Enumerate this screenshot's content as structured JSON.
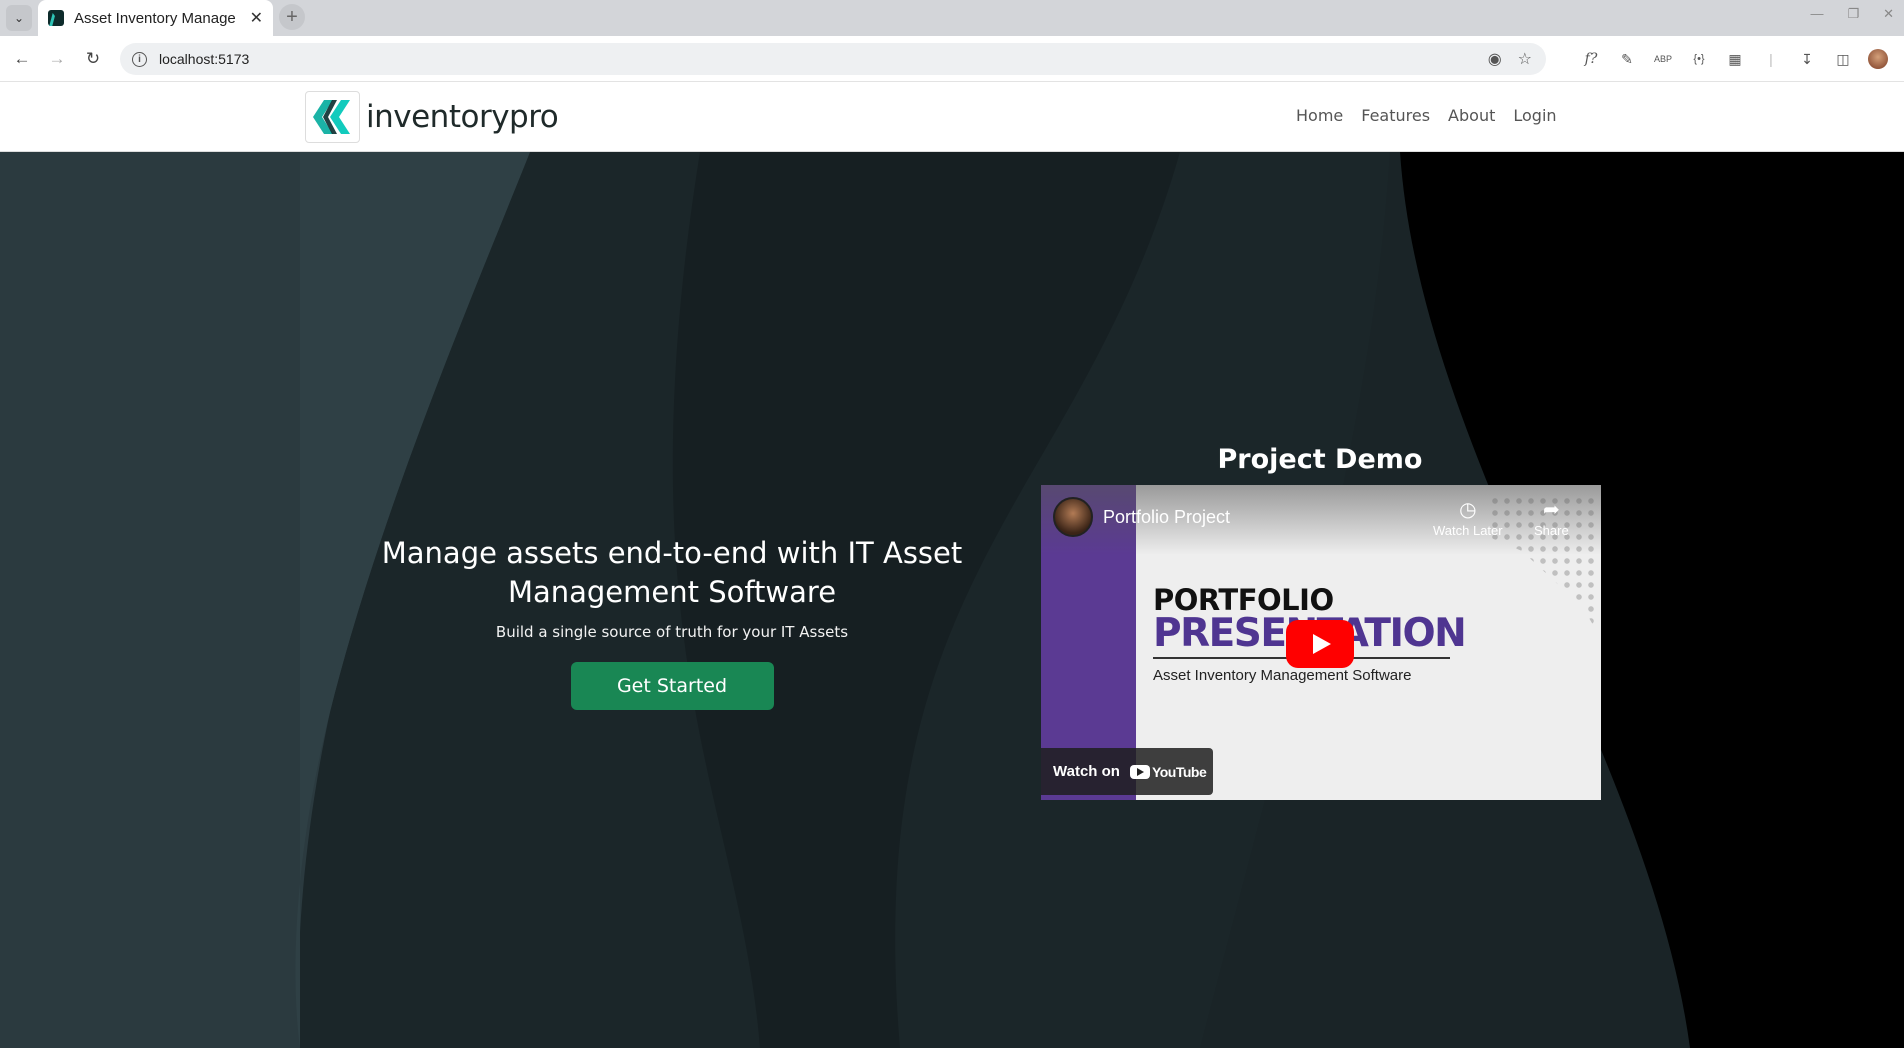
{
  "browser": {
    "tab_title": "Asset Inventory Manage",
    "url": "localhost:5173"
  },
  "site": {
    "brand": "inventorypro",
    "nav": [
      "Home",
      "Features",
      "About",
      "Login"
    ]
  },
  "hero": {
    "title": "Manage assets end-to-end with IT Asset Management Software",
    "subtitle": "Build a single source of truth for your IT Assets",
    "cta": "Get Started"
  },
  "demo": {
    "heading": "Project Demo",
    "video_title": "Portfolio Project",
    "watch_later": "Watch Later",
    "share": "Share",
    "thumb_line1": "PORTFOLIO",
    "thumb_line2": "PRESENTATION",
    "thumb_line3": "Asset Inventory Management Software",
    "watch_on": "Watch on",
    "youtube": "YouTube"
  },
  "colors": {
    "cta": "#198754",
    "brand_accent": "#2ec4b6",
    "thumb_purple": "#5b3a93",
    "youtube_red": "#ff0000"
  },
  "icons": {
    "tab_menu": "chevron-down-icon",
    "back": "arrow-left-icon",
    "forward": "arrow-right-icon",
    "reload": "reload-icon",
    "site_info": "info-icon",
    "eye": "eye-icon",
    "bookmark": "star-icon",
    "downloads": "download-icon",
    "sidebar": "sidebar-icon",
    "extensions": "puzzle-icon",
    "menu": "kebab-menu-icon"
  }
}
